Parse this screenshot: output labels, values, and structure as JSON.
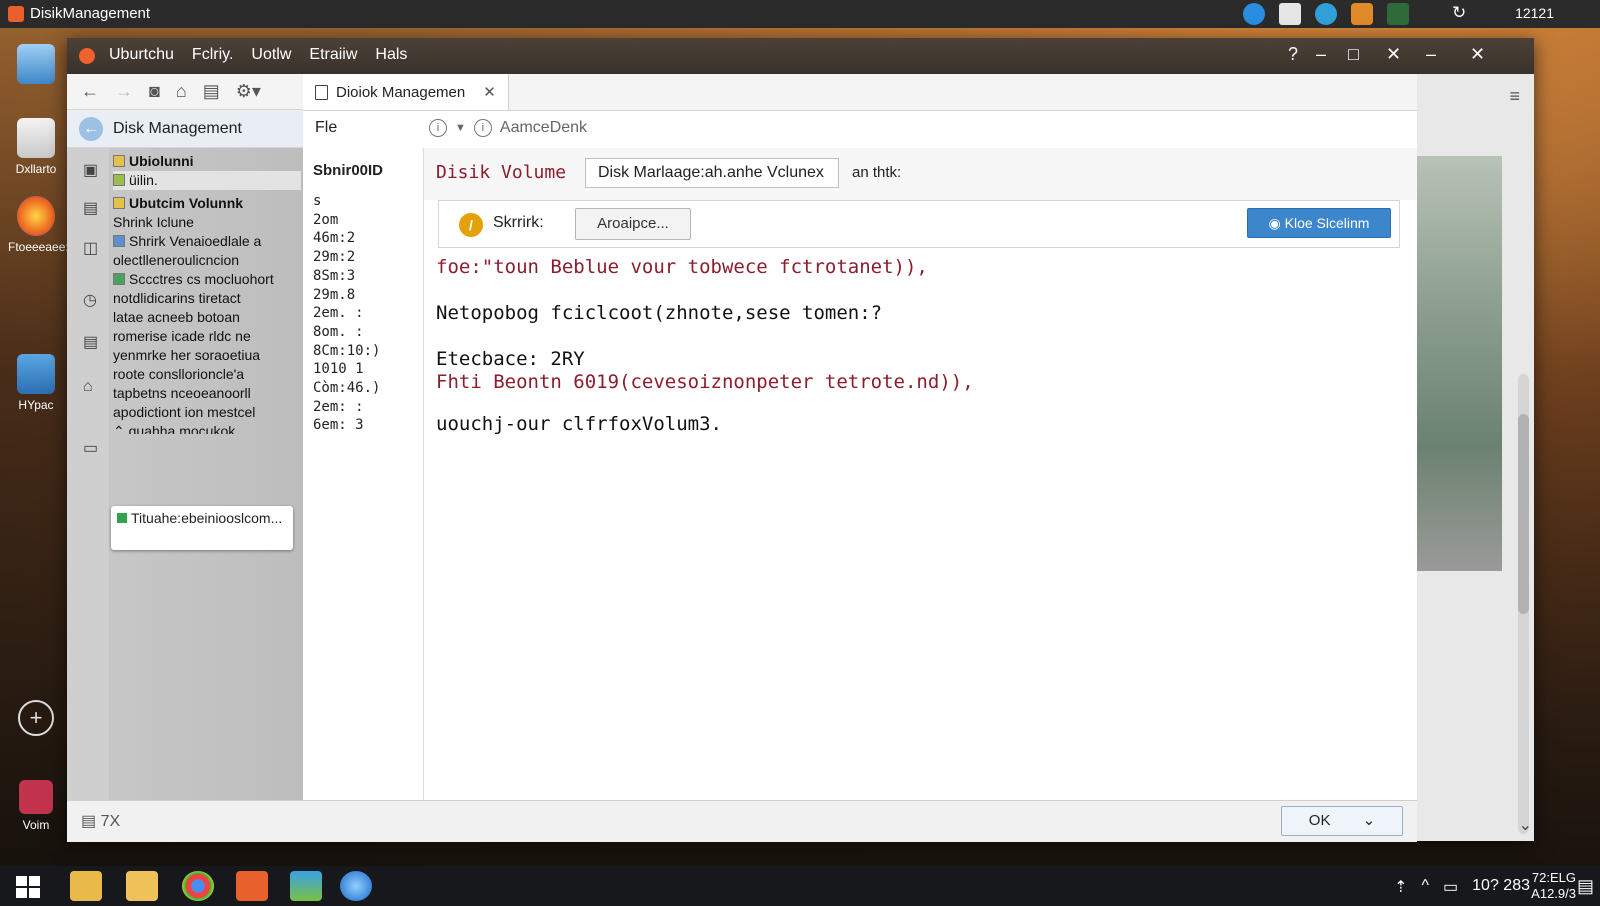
{
  "topbar": {
    "app_title": "DisikManagement",
    "clock": "12121"
  },
  "desktop_icons": [
    {
      "label": "Dxllarto"
    },
    {
      "label": "Ftoeeeaee:P"
    },
    {
      "label": "HYpac"
    },
    {
      "label": "Voim"
    }
  ],
  "window": {
    "menu": [
      "Uburtchu",
      "Fclriy.",
      "Uotlw",
      "Etraiiw",
      "Hals"
    ]
  },
  "tab": {
    "label": "Dioiok Managemen"
  },
  "nav": {
    "title": "Disk Management",
    "rows": [
      "Ubiolunni",
      "üilin.",
      "Ubutcim Volunnk",
      "Shrink Iclune",
      "Shrirk Venaioedlale a",
      "olectlleneroulicncion",
      "Sccctres cs mocluohort",
      "notdlidicarins tiretact",
      "latae acneeb botoan",
      "romerise icade rldc ne",
      "yenmrke her soraoetiua",
      "roote consllorioncle'a",
      "tapbetns nceoeanoorll",
      "apodictiont ion mestcel",
      "quahha mocukok"
    ],
    "popup": "Tituahe:ebeiniooslcom..."
  },
  "address": {
    "file": "Fle",
    "crumb": "AamceDenk"
  },
  "values": {
    "header": "Sbnir00ID",
    "items": [
      "s",
      "2om",
      "46m:2",
      "29m:2",
      "8Sm:3",
      "29m.8",
      "2em. :",
      "8om. :",
      "8Cm:10:)",
      "1010 1",
      "Còm:46.)",
      "2em: :",
      "6em: 3"
    ]
  },
  "content": {
    "title": "Disik Volume",
    "input_value": "Disk Marlaage:ah.anhe Vclunex",
    "after_input": "an thtk:",
    "shrink_label": "Skrrirk:",
    "browse_label": "Aroaipce...",
    "primary_label": "Kloe Slcelinm",
    "lines": [
      "foe:\"toun Beblue vour tobwece fctrotanet)),",
      "Netopobog fciclcoot(zhnote,sese tomen:?",
      "Etecbace: 2RY",
      "Fhti Beontn 6019(cevesoiznonpeter tetrote.nd)),",
      "uouchj-our clfrfoxVolum3."
    ]
  },
  "footer": {
    "ok_label": "OK",
    "left_label": "7X"
  },
  "taskbar": {
    "clock_top": "72:ELG",
    "clock_bottom": "A12.9/3",
    "tray_text": "10? 283"
  },
  "colors": {
    "accent": "#3c86cc",
    "title_red": "#8b1d2d",
    "window_title": "#3a322b",
    "warn": "#e4a10a"
  }
}
